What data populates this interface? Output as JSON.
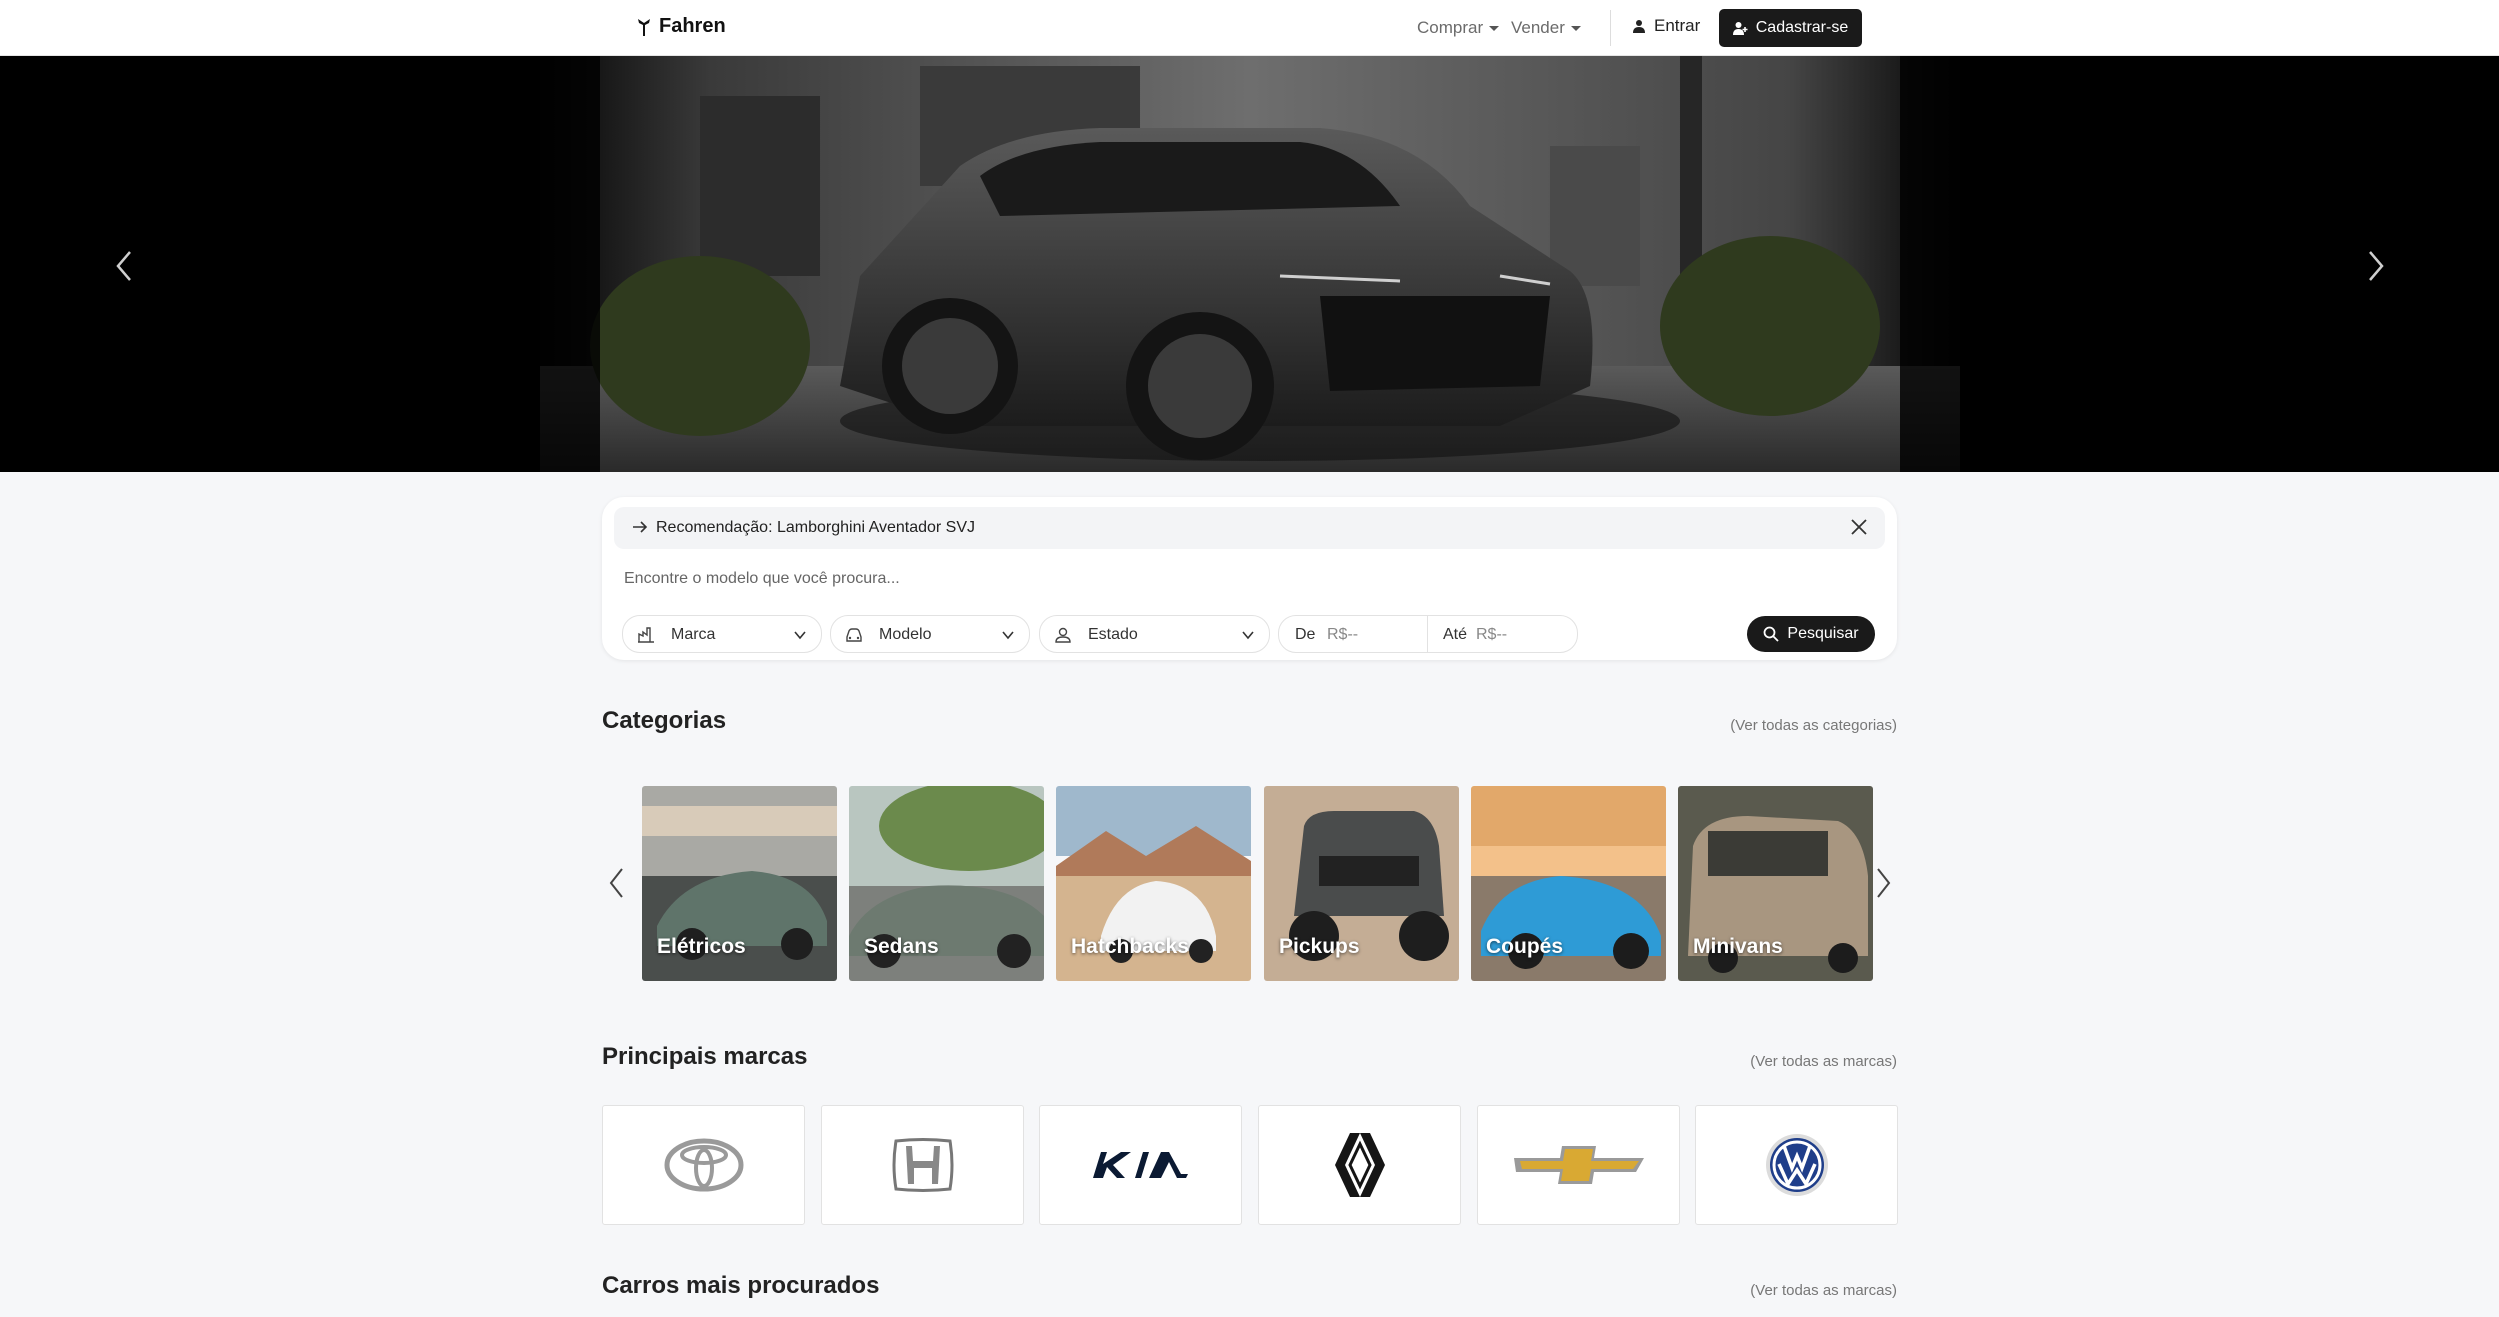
{
  "nav": {
    "brand": "Fahren",
    "buy": "Comprar",
    "sell": "Vender",
    "login": "Entrar",
    "signup": "Cadastrar-se"
  },
  "hero": {
    "icons": {
      "prev": "chevron-left-icon",
      "next": "chevron-right-icon"
    }
  },
  "search": {
    "recommendation": "Recomendação: Lamborghini Aventador SVJ",
    "placeholder": "Encontre o modelo que você procura...",
    "filters": {
      "brand": "Marca",
      "model": "Modelo",
      "state": "Estado"
    },
    "price": {
      "from_label": "De",
      "from_placeholder": "R$--",
      "to_label": "Até",
      "to_placeholder": "R$--"
    },
    "button": "Pesquisar"
  },
  "categories": {
    "title": "Categorias",
    "see_all": "(Ver todas as categorias)",
    "items": [
      {
        "label": "Elétricos",
        "color": "#5c6a63"
      },
      {
        "label": "Sedans",
        "color": "#6d7a70"
      },
      {
        "label": "Hatchbacks",
        "color": "#c99b70"
      },
      {
        "label": "Pickups",
        "color": "#b89a7c"
      },
      {
        "label": "Coupés",
        "color": "#2e9bd6"
      },
      {
        "label": "Minivans",
        "color": "#8d7d6a"
      }
    ]
  },
  "brands": {
    "title": "Principais marcas",
    "see_all": "(Ver todas as marcas)",
    "items": [
      "Toyota",
      "Honda",
      "Kia",
      "Renault",
      "Chevrolet",
      "Volkswagen"
    ]
  },
  "popular": {
    "title": "Carros mais procurados",
    "see_all": "(Ver todas as marcas)"
  }
}
